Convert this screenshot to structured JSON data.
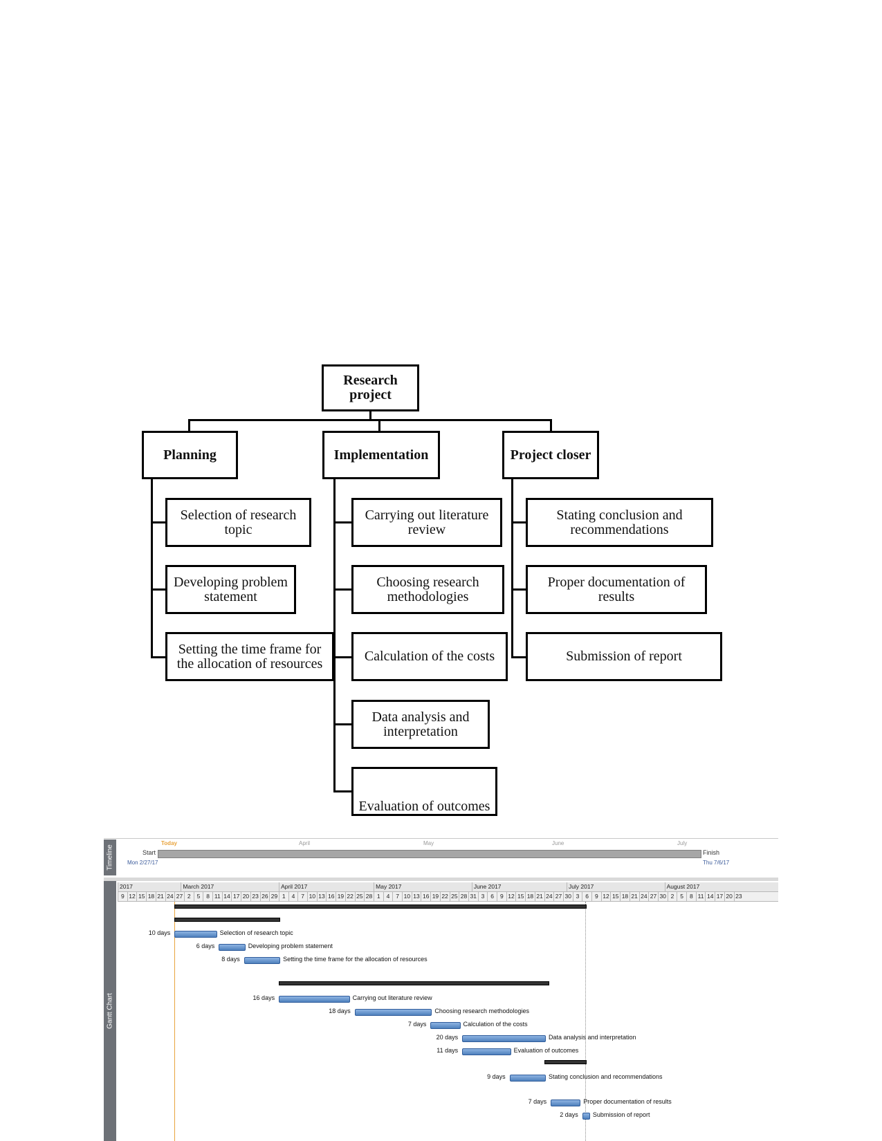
{
  "wbs": {
    "root": "Research project",
    "phases": [
      {
        "label": "Planning",
        "tasks": [
          "Selection of research topic",
          "Developing problem statement",
          "Setting the time frame for the allocation of resources"
        ]
      },
      {
        "label": "Implementation",
        "tasks": [
          "Carrying out literature review",
          "Choosing research methodologies",
          "Calculation of the costs",
          "Data analysis and interpretation",
          "Evaluation of outcomes"
        ]
      },
      {
        "label": "Project closer",
        "tasks": [
          "Stating conclusion and recommendations",
          "Proper documentation of results",
          "Submission of report"
        ]
      }
    ]
  },
  "gantt": {
    "timeline_tab": "Timeline",
    "gantt_tab": "Gantt Chart",
    "today_label": "Today",
    "start_label": "Start",
    "start_date": "Mon 2/27/17",
    "finish_label": "Finish",
    "finish_date": "Thu 7/6/17",
    "timeline_months": [
      "April",
      "May",
      "June",
      "July"
    ],
    "header_months": [
      "2017",
      "March 2017",
      "April 2017",
      "May 2017",
      "June 2017",
      "July 2017",
      "August 2017"
    ],
    "header_days": [
      "9",
      "12",
      "15",
      "18",
      "21",
      "24",
      "27",
      "2",
      "5",
      "8",
      "11",
      "14",
      "17",
      "20",
      "23",
      "26",
      "29",
      "1",
      "4",
      "7",
      "10",
      "13",
      "16",
      "19",
      "22",
      "25",
      "28",
      "1",
      "4",
      "7",
      "10",
      "13",
      "16",
      "19",
      "22",
      "25",
      "28",
      "31",
      "3",
      "6",
      "9",
      "12",
      "15",
      "18",
      "21",
      "24",
      "27",
      "30",
      "3",
      "6",
      "9",
      "12",
      "15",
      "18",
      "21",
      "24",
      "27",
      "30",
      "2",
      "5",
      "8",
      "11",
      "14",
      "17",
      "20",
      "23"
    ],
    "tasks": [
      {
        "duration": "10 days",
        "name": "Selection of research topic"
      },
      {
        "duration": "6 days",
        "name": "Developing problem statement"
      },
      {
        "duration": "8 days",
        "name": "Setting the time frame for the allocation of resources"
      },
      {
        "duration": "16 days",
        "name": "Carrying out literature review"
      },
      {
        "duration": "18 days",
        "name": "Choosing research methodologies"
      },
      {
        "duration": "7 days",
        "name": "Calculation of the costs"
      },
      {
        "duration": "20 days",
        "name": "Data analysis and interpretation"
      },
      {
        "duration": "11 days",
        "name": "Evaluation of outcomes"
      },
      {
        "duration": "9 days",
        "name": "Stating conclusion and recommendations"
      },
      {
        "duration": "7 days",
        "name": "Proper documentation of results"
      },
      {
        "duration": "2 days",
        "name": "Submission of report"
      }
    ]
  }
}
